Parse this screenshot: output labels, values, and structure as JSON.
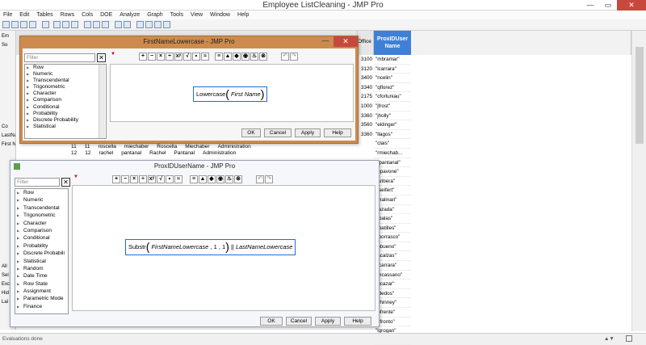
{
  "window": {
    "title": "Employee ListCleaning - JMP Pro",
    "min": "—",
    "max": "▭",
    "close": "✕"
  },
  "menu": [
    "File",
    "Edit",
    "Tables",
    "Rows",
    "Cols",
    "DOE",
    "Analyze",
    "Graph",
    "Tools",
    "View",
    "Window",
    "Help"
  ],
  "left_panel": [
    "Em",
    "So",
    "Co",
    "LastNameLowerca",
    "First Name",
    "All",
    "Sel",
    "Exc",
    "Hid",
    "Lal"
  ],
  "table": {
    "office_header": "Office",
    "prox_header_1": "ProxIDUser",
    "prox_header_2": "Name",
    "office_values": [
      "3100",
      "3120",
      "3400",
      "3340",
      "2175",
      "1000",
      "3360",
      "3560",
      "3360"
    ],
    "prox_values": [
      "\"mbramar\"",
      "\"lcarrara\"",
      "\"ncelin\"",
      "\"qflorez\"",
      "\"cforluniau\"",
      "\"jfrost\"",
      "\"jholly\"",
      "\"eklinger\"",
      "\"llagos\"",
      "\"clais\"",
      "\"rmiechab...",
      "\"rpantanal\"",
      "\"epavone\"",
      "\"aribera\"",
      "\"tseifert\"",
      "\"malinari\"",
      "\"lazada\"",
      "\"fbalas\"",
      "\"lbatilles\"",
      "\"lborrasco\"",
      "\"pbueno\"",
      "\"acalzas\"",
      "\"tcarrara\"",
      "\"mcassano\"",
      "\"gcazar\"",
      "\"ldedos\"",
      "\"yhinney\"",
      "\"bfrente\"",
      "\"vfronto\"",
      "\"lgrogan\"",
      "\"thagan\""
    ],
    "row_behind": {
      "row11": [
        "11",
        "11",
        "roscella",
        "miechaber",
        "Roscella",
        "Miechaber",
        "Administration"
      ],
      "row12": [
        "12",
        "12",
        "rachel",
        "pantanal",
        "Rachel",
        "Pantanal",
        "Administration"
      ]
    }
  },
  "status": "Evaluations done",
  "dialog1": {
    "title": "FirstNameLowercase - JMP Pro",
    "filter_placeholder": "Filter",
    "functions": [
      "Row",
      "Numeric",
      "Transcendental",
      "Trigonometric",
      "Character",
      "Comparison",
      "Conditional",
      "Probability",
      "Discrete Probability",
      "Statistical"
    ],
    "formula": {
      "func": "Lowercase",
      "arg": "First Name"
    },
    "buttons": {
      "ok": "OK",
      "cancel": "Cancel",
      "apply": "Apply",
      "help": "Help"
    },
    "operators": [
      "+",
      "−",
      "×",
      "÷",
      "xʸ",
      "√",
      "∘",
      "≈"
    ]
  },
  "dialog2": {
    "title": "ProxIDUserName - JMP Pro",
    "filter_placeholder": "Filter",
    "functions": [
      "Row",
      "Numeric",
      "Transcendental",
      "Trigonometric",
      "Character",
      "Comparison",
      "Conditional",
      "Probability",
      "Discrete Probabili",
      "Statistical",
      "Random",
      "Date Time",
      "Row State",
      "Assignment",
      "Parametric Mode",
      "Finance"
    ],
    "formula": {
      "func": "Substr",
      "arg1": "FirstNameLowercase",
      "arg2": "1",
      "arg3": "1",
      "concat": "||",
      "arg4": "LastNameLowercase"
    },
    "buttons": {
      "ok": "OK",
      "cancel": "Cancel",
      "apply": "Apply",
      "help": "Help"
    },
    "operators": [
      "+",
      "−",
      "×",
      "÷",
      "xʸ",
      "√",
      "∘",
      "≈"
    ]
  },
  "colors": {
    "accent": "#3f7fd6",
    "dialog_border": "#cc8b4c",
    "close": "#c7483c"
  }
}
